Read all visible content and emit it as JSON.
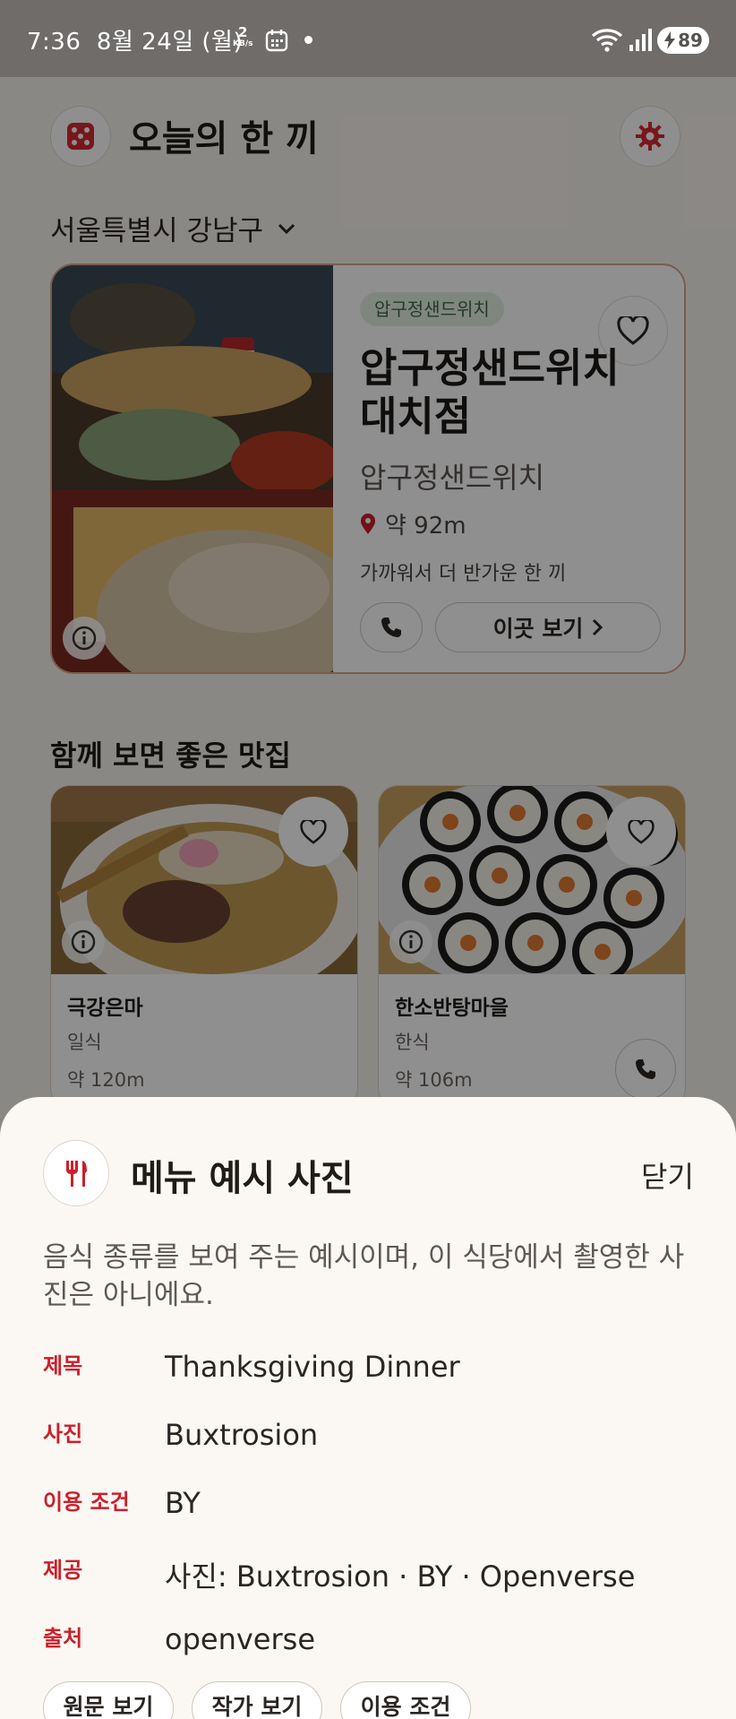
{
  "status_bar": {
    "time": "7:36",
    "date": "8월 24일 (월)",
    "net_speed": "2",
    "net_unit": "KB/s",
    "battery": "89"
  },
  "header": {
    "title": "오늘의 한 끼"
  },
  "location": {
    "label": "서울특별시 강남구"
  },
  "featured": {
    "chip": "압구정샌드위치",
    "name": "압구정샌드위치 대치점",
    "subtitle": "압구정샌드위치",
    "distance": "약 92m",
    "tagline": "가까워서 더 반가운 한 끼",
    "view_button": "이곳 보기"
  },
  "recommendations": {
    "title": "함께 보면 좋은 맛집",
    "items": [
      {
        "name": "극강은마",
        "category": "일식",
        "distance": "약 120m"
      },
      {
        "name": "한소반탕마을",
        "category": "한식",
        "distance": "약 106m"
      }
    ]
  },
  "sheet": {
    "title": "메뉴 예시 사진",
    "close_label": "닫기",
    "description": "음식 종류를 보여 주는 예시이며, 이 식당에서 촬영한 사진은 아니에요.",
    "rows": [
      {
        "key": "제목",
        "value": "Thanksgiving Dinner"
      },
      {
        "key": "사진",
        "value": "Buxtrosion"
      },
      {
        "key": "이용 조건",
        "value": "BY"
      },
      {
        "key": "제공",
        "value": "사진: Buxtrosion · BY · Openverse"
      },
      {
        "key": "출처",
        "value": "openverse"
      }
    ],
    "buttons": [
      "원문 보기",
      "작가 보기",
      "이용 조건"
    ]
  },
  "colors": {
    "accent_red": "#cc1f2b",
    "chip_green_bg": "#e3efe4",
    "sheet_bg": "#fbf8f3"
  }
}
